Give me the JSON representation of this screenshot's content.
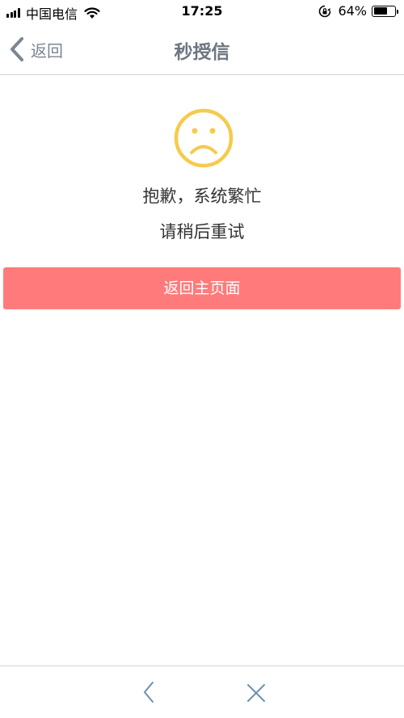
{
  "status_bar": {
    "carrier": "中国电信",
    "time": "17:25",
    "battery_percent": "64%",
    "battery_level": 0.64,
    "icons": [
      "signal-icon",
      "wifi-icon",
      "rotation-lock-icon",
      "battery-icon"
    ]
  },
  "nav": {
    "back_label": "返回",
    "title": "秒授信"
  },
  "main": {
    "icon": "sad-face-icon",
    "icon_color": "#f5cb4c",
    "message_line1": "抱歉，系统繁忙",
    "message_line2": "请稍后重试",
    "home_button_label": "返回主页面",
    "home_button_color": "#ff7b7b"
  },
  "toolbar": {
    "icons": [
      "back-arrow-icon",
      "close-icon"
    ],
    "icon_color": "#6f8fb0"
  }
}
